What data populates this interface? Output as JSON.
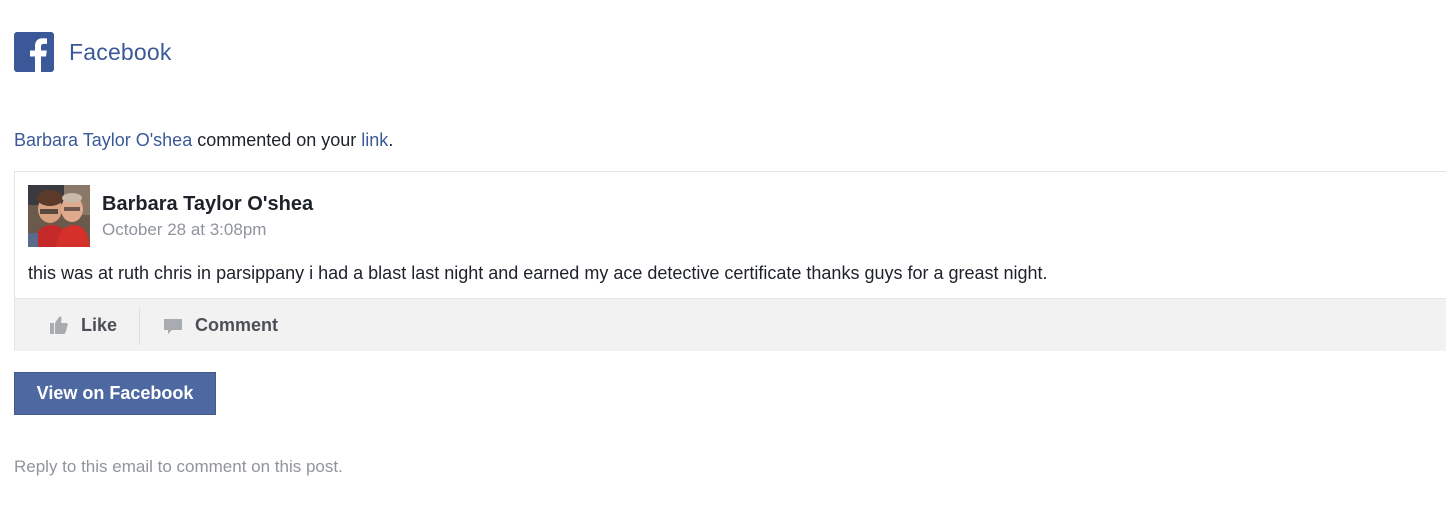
{
  "header": {
    "brand": "Facebook",
    "logo_icon": "facebook-f-icon",
    "brand_color": "#3b5998"
  },
  "notice": {
    "actor": "Barbara Taylor O'shea",
    "middle": " commented on your ",
    "object": "link",
    "end": "."
  },
  "post": {
    "author": "Barbara Taylor O'shea",
    "timestamp": "October 28 at 3:08pm",
    "text": "this was at ruth chris in parsippany i had a blast last night and earned my ace detective certificate thanks guys for a greast night.",
    "actions": {
      "like_label": "Like",
      "like_icon": "thumbs-up-icon",
      "comment_label": "Comment",
      "comment_icon": "speech-bubble-icon"
    }
  },
  "view_button": {
    "label": "View on Facebook",
    "color": "#4e69a2"
  },
  "footer": {
    "text": "Reply to this email to comment on this post."
  }
}
